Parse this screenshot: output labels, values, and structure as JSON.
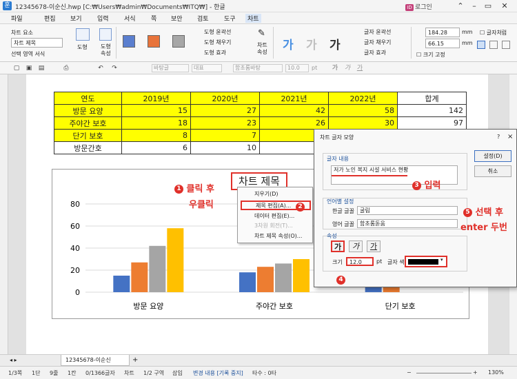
{
  "window": {
    "title": "12345678-이순신.hwp [C:₩Users₩admin₩Documents₩ITQ₩] - 한글",
    "login_label": "로그인"
  },
  "menu": [
    "파일",
    "편집",
    "보기",
    "입력",
    "서식",
    "쪽",
    "보안",
    "검토",
    "도구",
    "차트"
  ],
  "ribbon": {
    "chart_element_label": "차트 요소",
    "chart_element_value": "차트 제목",
    "select_format": "선택 영역 서식",
    "shape_label": "도형",
    "shape_prop_label": "도형 속성",
    "shape_outline": "도형 윤곽선",
    "shape_fill": "도형 채우기",
    "shape_effect": "도형 효과",
    "chart_prop": "차트 속성",
    "text_outline": "글자 윤곽선",
    "text_fill": "글자 채우기",
    "text_effect": "글자 효과",
    "width": "184.28",
    "height": "66.15",
    "unit": "mm",
    "size_fixed": "크기 고정",
    "text_wrap": "글자처럼",
    "style_glyph": "가",
    "swatch_colors": [
      "#5b7fcf",
      "#e8743b",
      "#a7a7a7"
    ]
  },
  "toolbar2": {
    "style": "바탕글",
    "group": "대표",
    "font": "함초롬바탕",
    "size": "10.0",
    "unit": "pt"
  },
  "table": {
    "header": [
      "연도",
      "2019년",
      "2020년",
      "2021년",
      "2022년",
      "합계"
    ],
    "rows": [
      {
        "label": "방문 요양",
        "values": [
          "15",
          "27",
          "42",
          "58"
        ],
        "total": "142"
      },
      {
        "label": "주야간 보호",
        "values": [
          "18",
          "23",
          "26",
          "30"
        ],
        "total": "97"
      },
      {
        "label": "단기 보호",
        "values": [
          "8",
          "7",
          "",
          ""
        ],
        "total": ""
      },
      {
        "label": "방문간호",
        "values": [
          "6",
          "10",
          "",
          ""
        ],
        "total": ""
      }
    ]
  },
  "chart_data": {
    "type": "bar",
    "title": "차트 제목",
    "categories": [
      "방문 요양",
      "주야간 보호",
      "단기 보호"
    ],
    "series": [
      {
        "values": [
          15,
          18,
          8
        ]
      },
      {
        "values": [
          27,
          23,
          7
        ]
      },
      {
        "values": [
          42,
          26,
          0
        ]
      },
      {
        "values": [
          58,
          30,
          0
        ]
      }
    ],
    "colors": [
      "#4472c4",
      "#ed7d31",
      "#a5a5a5",
      "#ffc000"
    ],
    "ylim": [
      0,
      80
    ],
    "yticks": [
      0,
      20,
      40,
      60,
      80
    ],
    "grid": true
  },
  "context_menu": {
    "items": [
      {
        "label": "지우기(D)",
        "enabled": true
      },
      {
        "label": "제목 편집(A)...",
        "enabled": true
      },
      {
        "label": "데이터 편집(E)...",
        "enabled": true
      },
      {
        "label": "3차원 회전(T)...",
        "enabled": false
      },
      {
        "label": "차트 제목 속성(O)...",
        "enabled": true
      }
    ]
  },
  "annotations": {
    "a1": "클릭 후",
    "a1b": "우클릭",
    "a3": "입력",
    "a5": "선택 후",
    "a5b": "enter 두번",
    "n1": "1",
    "n2": "2",
    "n3": "3",
    "n4": "4",
    "n5": "5"
  },
  "dialog": {
    "title": "차트 글자 모양",
    "help": "?",
    "close": "×",
    "content_group": "글자 내용",
    "content_text": "저가 노인 복지 시설 서비스 현황",
    "lang_group": "언어별 설정",
    "korean_font_label": "한글 글꼴",
    "korean_font": "굴림",
    "english_font_label": "영어 글꼴",
    "english_font": "함초롬돋움",
    "attr_group": "속성",
    "style_buttons": [
      "가",
      "가",
      "가"
    ],
    "size_label": "크기",
    "size_value": "12.0",
    "size_unit": "pt",
    "color_label": "글자 색",
    "ok": "설정(D)",
    "cancel": "취소"
  },
  "tabs": {
    "doc_tab": "12345678-이순신"
  },
  "status": {
    "page": "1/3쪽",
    "section": "1단",
    "line": "9줄",
    "col": "1칸",
    "chars": "0/1366글자",
    "mode": "차트",
    "area": "1/2 구역",
    "insert": "삽입",
    "track": "변경 내용 [기록 중지]",
    "typo": "타수 : 0타",
    "zoom": "130%"
  }
}
